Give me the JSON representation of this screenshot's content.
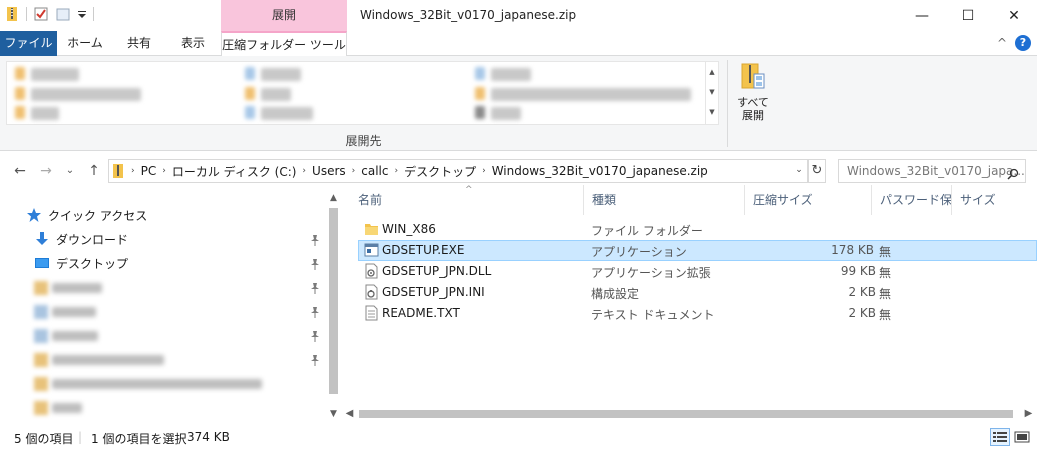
{
  "window": {
    "title": "Windows_32Bit_v0170_japanese.zip",
    "context_group": "展開",
    "controls": {
      "minimize": "—",
      "maximize": "☐",
      "close": "✕"
    }
  },
  "tabs": {
    "file": "ファイル",
    "home": "ホーム",
    "share": "共有",
    "view": "表示",
    "tools": "圧縮フォルダー ツール",
    "collapse": "^",
    "help": "?"
  },
  "ribbon": {
    "group_label": "展開先",
    "extract_all_label": "すべて展開"
  },
  "address": {
    "back": "←",
    "forward": "→",
    "recent": "⌄",
    "up": "↑",
    "crumbs": [
      "PC",
      "ローカル ディスク (C:)",
      "Users",
      "callc",
      "デスクトップ",
      "Windows_32Bit_v0170_japanese.zip"
    ],
    "refresh": "↻",
    "search_placeholder": "Windows_32Bit_v0170_japa..."
  },
  "nav": {
    "quick_access": "クイック アクセス",
    "downloads": "ダウンロード",
    "desktop": "デスクトップ",
    "pin_glyph": "📌"
  },
  "columns": {
    "name": "名前",
    "type": "種類",
    "compressed_size": "圧縮サイズ",
    "password": "パスワード保...",
    "size": "サイズ"
  },
  "files": [
    {
      "name": "WIN_X86",
      "type": "ファイル フォルダー",
      "csize": "",
      "pw": "",
      "icon": "folder-icon"
    },
    {
      "name": "GDSETUP.EXE",
      "type": "アプリケーション",
      "csize": "178 KB",
      "pw": "無",
      "icon": "application-icon"
    },
    {
      "name": "GDSETUP_JPN.DLL",
      "type": "アプリケーション拡張",
      "csize": "99 KB",
      "pw": "無",
      "icon": "dll-file-icon"
    },
    {
      "name": "GDSETUP_JPN.INI",
      "type": "構成設定",
      "csize": "2 KB",
      "pw": "無",
      "icon": "ini-file-icon"
    },
    {
      "name": "README.TXT",
      "type": "テキスト ドキュメント",
      "csize": "2 KB",
      "pw": "無",
      "icon": "text-file-icon"
    }
  ],
  "status": {
    "item_count": "5 個の項目",
    "selection": "1 個の項目を選択",
    "selection_size": "374 KB"
  },
  "colors": {
    "file_tab": "#1f5f9f",
    "context_tab": "#f9c5dc",
    "selection": "#cce8ff",
    "folder": "#f3c34c"
  }
}
